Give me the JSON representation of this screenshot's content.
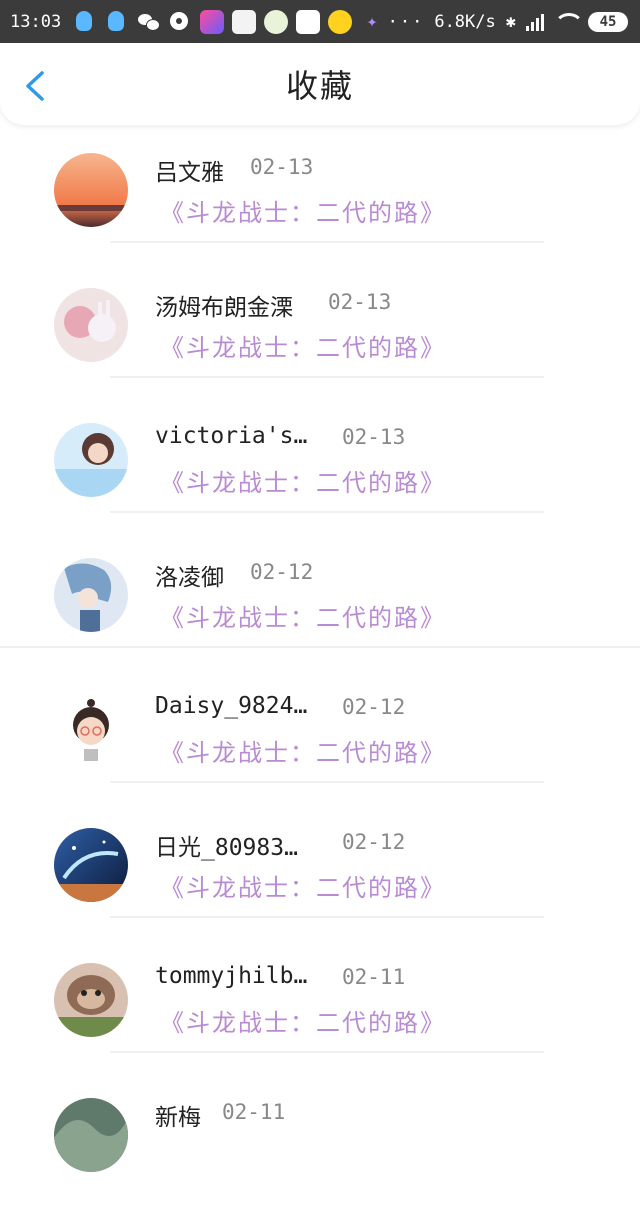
{
  "status_bar": {
    "time": "13:03",
    "network_speed": "6.8K/s",
    "battery": "45",
    "app_icons": [
      "qq-icon",
      "qq-icon",
      "wechat-icon",
      "music-icon",
      "youku-icon",
      "app-icon",
      "app-icon",
      "triangle-app-icon",
      "yellow-app-icon",
      "purple-app-icon"
    ]
  },
  "header": {
    "title": "收藏"
  },
  "items": [
    {
      "name": "吕文雅",
      "date": "02-13",
      "book": "《斗龙战士：二代的路》",
      "avatar_color": "#f08a5d"
    },
    {
      "name": "汤姆布朗金溧",
      "date": "02-13",
      "book": "《斗龙战士：二代的路》",
      "avatar_color": "#e9d6d6"
    },
    {
      "name": "victoria's…",
      "date": "02-13",
      "book": "《斗龙战士：二代的路》",
      "avatar_color": "#cfe8ff"
    },
    {
      "name": "洛凌御",
      "date": "02-12",
      "book": "《斗龙战士：二代的路》",
      "avatar_color": "#c9d7ee"
    },
    {
      "name": "Daisy_9824…",
      "date": "02-12",
      "book": "《斗龙战士：二代的路》",
      "avatar_color": "#ffffff"
    },
    {
      "name": "日光_80983…",
      "date": "02-12",
      "book": "《斗龙战士：二代的路》",
      "avatar_color": "#1b2c5a"
    },
    {
      "name": "tommyjhilb…",
      "date": "02-11",
      "book": "《斗龙战士：二代的路》",
      "avatar_color": "#8b6a55"
    },
    {
      "name": "新梅",
      "date": "02-11",
      "book": "",
      "avatar_color": "#6f8b78"
    }
  ]
}
